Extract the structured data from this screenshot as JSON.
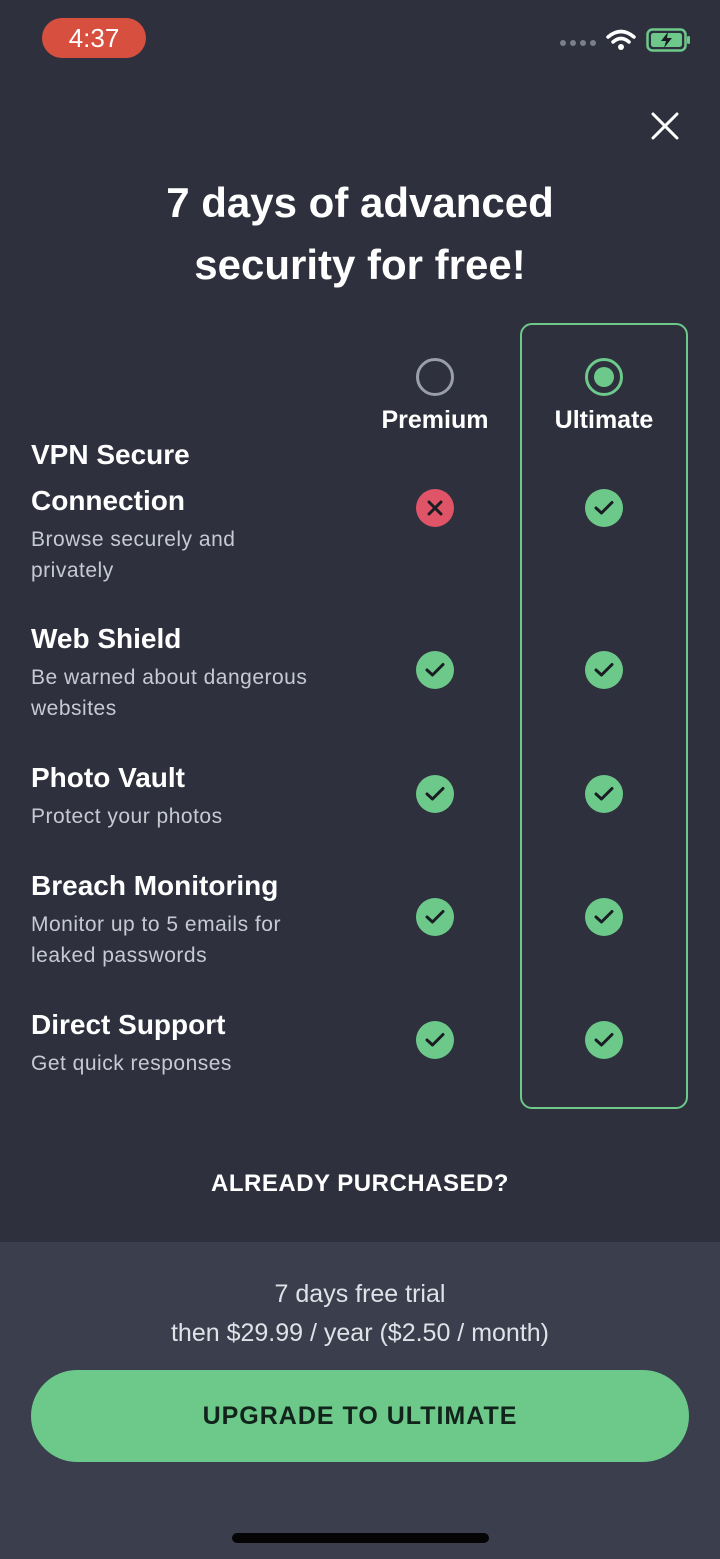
{
  "status": {
    "time": "4:37"
  },
  "header": {
    "title_line1": "7 days of advanced",
    "title_line2": "security for free!"
  },
  "plans": [
    {
      "name": "Premium",
      "selected": false
    },
    {
      "name": "Ultimate",
      "selected": true
    }
  ],
  "features": [
    {
      "title_line1": "VPN Secure",
      "title_line2": "Connection",
      "desc_line1": "Browse securely and",
      "desc_line2": "privately",
      "premium": false,
      "ultimate": true
    },
    {
      "title_line1": "Web Shield",
      "desc_line1": "Be warned about dangerous",
      "desc_line2": "websites",
      "premium": true,
      "ultimate": true
    },
    {
      "title_line1": "Photo Vault",
      "desc_line1": "Protect your photos",
      "premium": true,
      "ultimate": true
    },
    {
      "title_line1": "Breach Monitoring",
      "desc_line1": "Monitor up to 5 emails for",
      "desc_line2": "leaked passwords",
      "premium": true,
      "ultimate": true
    },
    {
      "title_line1": "Direct Support",
      "desc_line1": "Get quick responses",
      "premium": true,
      "ultimate": true
    }
  ],
  "already_purchased": "ALREADY PURCHASED?",
  "trial": {
    "line1": "7 days free trial",
    "line2": "then $29.99 / year ($2.50 / month)"
  },
  "cta": {
    "label": "UPGRADE TO ULTIMATE"
  },
  "colors": {
    "background": "#2e313d",
    "panel": "#3b3f4d",
    "accent": "#6cc98a",
    "cross": "#e05468",
    "time_pill": "#d64f3f"
  },
  "icons": [
    "wifi-icon",
    "battery-charging-icon",
    "close-icon",
    "check-icon",
    "cross-icon",
    "radio-icon"
  ]
}
